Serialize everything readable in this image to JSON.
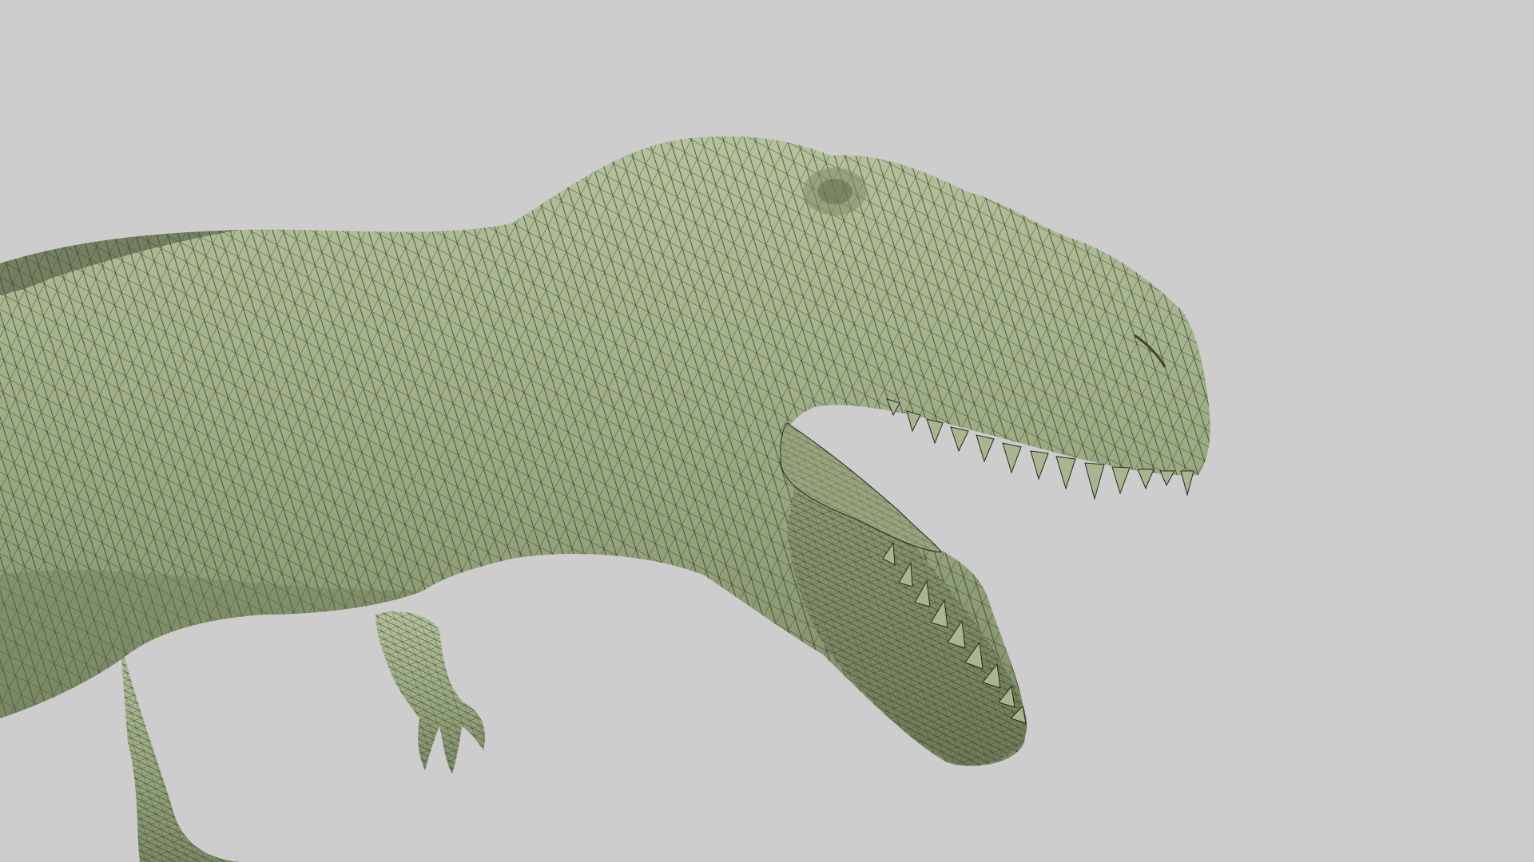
{
  "viewport": {
    "background_color": "#cdcdcd",
    "model": {
      "subject": "dinosaur",
      "shading": "wireframe-on-shaded",
      "surface_color": "#9fae85",
      "wire_color": "#1f2a17"
    }
  }
}
